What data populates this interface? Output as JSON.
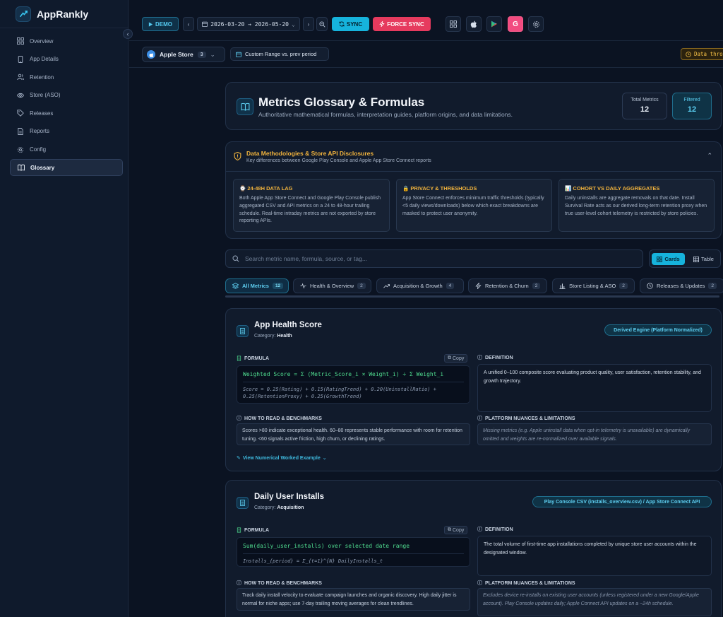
{
  "app": {
    "name": "AppRankly"
  },
  "sidebar": {
    "items": [
      {
        "label": "Overview",
        "icon": "grid-icon"
      },
      {
        "label": "App Details",
        "icon": "phone-icon"
      },
      {
        "label": "Retention",
        "icon": "users-icon"
      },
      {
        "label": "Store (ASO)",
        "icon": "eye-icon"
      },
      {
        "label": "Releases",
        "icon": "tag-icon"
      },
      {
        "label": "Reports",
        "icon": "document-icon"
      },
      {
        "label": "Config",
        "icon": "gear-icon"
      },
      {
        "label": "Glossary",
        "icon": "book-icon",
        "active": true
      }
    ]
  },
  "topbar": {
    "demo_label": "DEMO",
    "date_range": "2026-03-20 → 2026-05-20",
    "sync_label": "SYNC",
    "force_sync_label": "FORCE SYNC",
    "google_letter": "G"
  },
  "subbar": {
    "store_label": "Apple Store",
    "store_count": "3",
    "range_label": "Custom Range vs. prev period",
    "data_chip": "Data thro"
  },
  "header": {
    "title": "Metrics Glossary & Formulas",
    "subtitle": "Authoritative mathematical formulas, interpretation guides, platform origins, and data limitations.",
    "total_label": "Total Metrics",
    "total_value": "12",
    "filtered_label": "Filtered",
    "filtered_value": "12"
  },
  "methodology": {
    "title": "Data Methodologies & Store API Disclosures",
    "subtitle": "Key differences between Google Play Console and Apple App Store Connect reports",
    "boxes": [
      {
        "title": "⌚ 24-48H DATA LAG",
        "text": "Both Apple App Store Connect and Google Play Console publish aggregated CSV and API metrics on a 24 to 48-hour trailing schedule. Real-time intraday metrics are not exported by store reporting APIs."
      },
      {
        "title": "🔒 PRIVACY & THRESHOLDS",
        "text": "App Store Connect enforces minimum traffic thresholds (typically <5 daily views/downloads) below which exact breakdowns are masked to protect user anonymity."
      },
      {
        "title": "📊 COHORT VS DAILY AGGREGATES",
        "text": "Daily uninstalls are aggregate removals on that date. Install Survival Rate acts as our derived long-term retention proxy when true user-level cohort telemetry is restricted by store policies."
      }
    ]
  },
  "search": {
    "placeholder": "Search metric name, formula, source, or tag..."
  },
  "view_toggle": {
    "cards": "Cards",
    "table": "Table"
  },
  "tabs": [
    {
      "label": "All Metrics",
      "count": "12",
      "icon": "layers-icon",
      "active": true
    },
    {
      "label": "Health & Overview",
      "count": "2",
      "icon": "pulse-icon"
    },
    {
      "label": "Acquisition & Growth",
      "count": "4",
      "icon": "trend-up-icon"
    },
    {
      "label": "Retention & Churn",
      "count": "2",
      "icon": "bolt-icon"
    },
    {
      "label": "Store Listing & ASO",
      "count": "2",
      "icon": "bar-chart-icon"
    },
    {
      "label": "Releases & Updates",
      "count": "2",
      "icon": "history-icon"
    }
  ],
  "section_labels": {
    "formula": "FORMULA",
    "definition": "DEFINITION",
    "how_to_read": "HOW TO READ & BENCHMARKS",
    "nuances": "PLATFORM NUANCES & LIMITATIONS",
    "copy": "Copy",
    "category_prefix": "Category:"
  },
  "metrics": [
    {
      "title": "App Health Score",
      "category": "Health",
      "source": "Derived Engine (Platform Normalized)",
      "formula_main": "Weighted Score = Σ (Metric_Score_i × Weight_i) ÷ Σ Weight_i",
      "formula_alt": "Score = 0.25(Rating) + 0.15(RatingTrend) + 0.20(UninstallRatio) + 0.25(RetentionProxy) + 0.25(GrowthTrend)",
      "definition": "A unified 0–100 composite score evaluating product quality, user satisfaction, retention stability, and growth trajectory.",
      "how_to_read": "Scores >80 indicate exceptional health. 60–80 represents stable performance with room for retention tuning. <60 signals active friction, high churn, or declining ratings.",
      "nuances": "Missing metrics (e.g. Apple uninstall data when opt-in telemetry is unavailable) are dynamically omitted and weights are re-normalized over available signals.",
      "worked_example": "View Numerical Worked Example"
    },
    {
      "title": "Daily User Installs",
      "category": "Acquisition",
      "source": "Play Console CSV (installs_overview.csv) / App Store Connect API",
      "formula_main": "Sum(daily_user_installs) over selected date range",
      "formula_alt": "Installs_{period} = Σ_{t=1}^{N} DailyInstalls_t",
      "definition": "The total volume of first-time app installations completed by unique store user accounts within the designated window.",
      "how_to_read": "Track daily install velocity to evaluate campaign launches and organic discovery. High daily jitter is normal for niche apps; use 7-day trailing moving averages for clean trendlines.",
      "nuances": "Excludes device re-installs on existing user accounts (unless registered under a new Google/Apple account). Play Console updates daily; Apple Connect API updates on a ~24h schedule."
    }
  ],
  "colors": {
    "accent": "#16b3dc",
    "danger": "#e63a5e",
    "warning": "#f2b43d",
    "formula": "#4fdc8f",
    "background": "#0b1322"
  }
}
